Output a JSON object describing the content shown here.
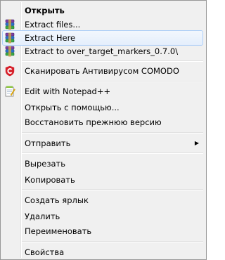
{
  "menu": {
    "open": "Открыть",
    "extract_files": "Extract files...",
    "extract_here": "Extract Here",
    "extract_to": "Extract to over_target_markers_0.7.0\\",
    "scan_comodo": "Сканировать Антивирусом COMODO",
    "edit_notepad": "Edit with Notepad++",
    "open_with": "Открыть с помощью...",
    "restore_version": "Восстановить прежнюю версию",
    "send_to": "Отправить",
    "cut": "Вырезать",
    "copy": "Копировать",
    "create_shortcut": "Создать ярлык",
    "delete": "Удалить",
    "rename": "Переименовать",
    "properties": "Свойства"
  },
  "icons": {
    "winrar": "winrar-icon",
    "comodo": "comodo-icon",
    "notepad": "notepad-plus-plus-icon",
    "submenu": "chevron-right-icon"
  },
  "colors": {
    "menu_background": "#f0f0f0",
    "hover_border": "#aecff7",
    "comodo_red": "#d6202a"
  }
}
